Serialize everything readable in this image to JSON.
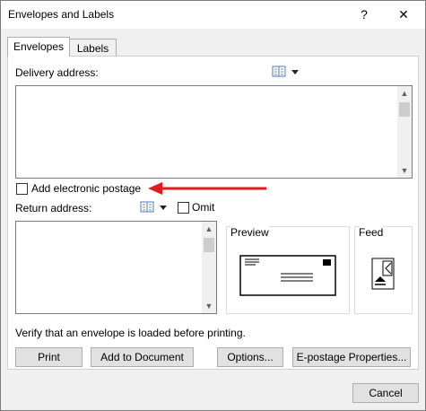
{
  "window": {
    "title": "Envelopes and Labels",
    "help": "?",
    "close": "✕"
  },
  "tabs": [
    {
      "label": "Envelopes"
    },
    {
      "label": "Labels"
    }
  ],
  "delivery": {
    "label": "Delivery address:",
    "value": ""
  },
  "postage": {
    "label": "Add electronic postage",
    "checked": false
  },
  "return_address": {
    "label": "Return address:",
    "value": "",
    "omit_label": "Omit",
    "omit_checked": false
  },
  "preview": {
    "label": "Preview"
  },
  "feed": {
    "label": "Feed"
  },
  "verify_text": "Verify that an envelope is loaded before printing.",
  "buttons": {
    "print": "Print",
    "add_to_document": "Add to Document",
    "options": "Options...",
    "epostage": "E-postage Properties...",
    "cancel": "Cancel"
  },
  "annotation_arrow_color": "#e21b1b"
}
